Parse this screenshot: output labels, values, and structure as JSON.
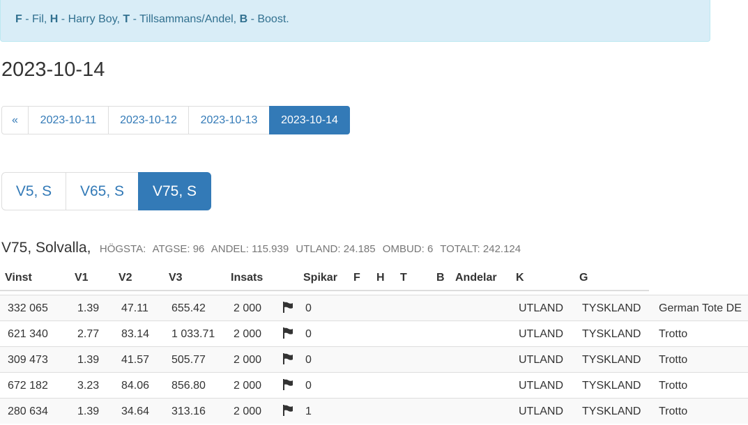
{
  "legend": {
    "items": [
      {
        "key": "F",
        "desc": " - Fil, "
      },
      {
        "key": "H",
        "desc": " - Harry Boy, "
      },
      {
        "key": "T",
        "desc": " - Tillsammans/Andel, "
      },
      {
        "key": "B",
        "desc": " - Boost."
      }
    ]
  },
  "date_heading": "2023-10-14",
  "pager": [
    "«",
    "2023-10-11",
    "2023-10-12",
    "2023-10-13",
    "2023-10-14"
  ],
  "games": [
    "V5, S",
    "V65, S",
    "V75, S"
  ],
  "race": {
    "name": "V75, Solvalla,",
    "stats": [
      "HÖGSTA:",
      "ATGSE: 96",
      "ANDEL: 115.939",
      "UTLAND: 24.185",
      "OMBUD: 6",
      "TOTALT: 242.124"
    ]
  },
  "columns": [
    "Vinst",
    "V1",
    "V2",
    "V3",
    "Insats",
    "Spikar",
    "F",
    "H",
    "T",
    "B",
    "Andelar",
    "K",
    "G"
  ],
  "rows": [
    {
      "vinst": "332 065",
      "v1": "1.39",
      "v2": "47.11",
      "v3": "655.42",
      "insats": "2 000",
      "spikar": "0",
      "k": "UTLAND",
      "g": "TYSKLAND",
      "extra": "German Tote DE"
    },
    {
      "vinst": "621 340",
      "v1": "2.77",
      "v2": "83.14",
      "v3": "1 033.71",
      "insats": "2 000",
      "spikar": "0",
      "k": "UTLAND",
      "g": "TYSKLAND",
      "extra": "Trotto"
    },
    {
      "vinst": "309 473",
      "v1": "1.39",
      "v2": "41.57",
      "v3": "505.77",
      "insats": "2 000",
      "spikar": "0",
      "k": "UTLAND",
      "g": "TYSKLAND",
      "extra": "Trotto"
    },
    {
      "vinst": "672 182",
      "v1": "3.23",
      "v2": "84.06",
      "v3": "856.80",
      "insats": "2 000",
      "spikar": "0",
      "k": "UTLAND",
      "g": "TYSKLAND",
      "extra": "Trotto"
    },
    {
      "vinst": "280 634",
      "v1": "1.39",
      "v2": "34.64",
      "v3": "313.16",
      "insats": "2 000",
      "spikar": "1",
      "k": "UTLAND",
      "g": "TYSKLAND",
      "extra": "Trotto"
    }
  ]
}
